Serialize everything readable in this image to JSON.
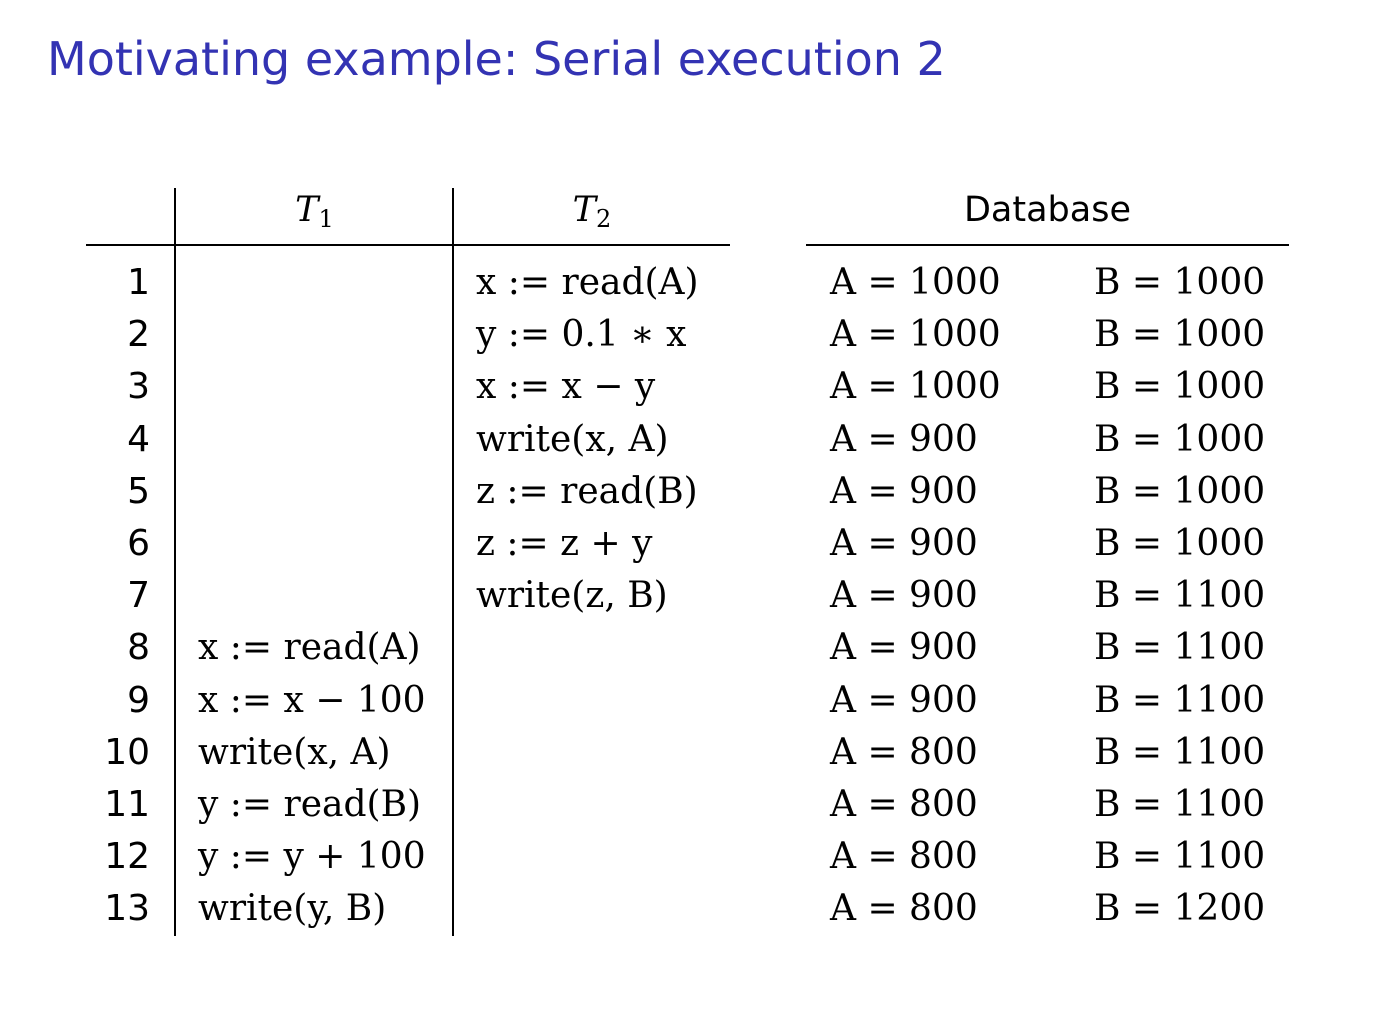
{
  "slide": {
    "title": "Motivating example: Serial execution 2"
  },
  "table": {
    "header": {
      "t1_symbol": "T",
      "t1_sub": "1",
      "t2_symbol": "T",
      "t2_sub": "2",
      "database": "Database"
    },
    "rows": [
      {
        "n": "1",
        "t1": "",
        "t2": "x := read(A)",
        "a": "A = 1000",
        "b": "B = 1000"
      },
      {
        "n": "2",
        "t1": "",
        "t2": "y := 0.1 ∗ x",
        "a": "A = 1000",
        "b": "B = 1000"
      },
      {
        "n": "3",
        "t1": "",
        "t2": "x := x − y",
        "a": "A = 1000",
        "b": "B = 1000"
      },
      {
        "n": "4",
        "t1": "",
        "t2": "write(x, A)",
        "a": "A = 900",
        "b": "B = 1000"
      },
      {
        "n": "5",
        "t1": "",
        "t2": "z := read(B)",
        "a": "A = 900",
        "b": "B = 1000"
      },
      {
        "n": "6",
        "t1": "",
        "t2": "z := z + y",
        "a": "A = 900",
        "b": "B = 1000"
      },
      {
        "n": "7",
        "t1": "",
        "t2": "write(z, B)",
        "a": "A = 900",
        "b": "B = 1100"
      },
      {
        "n": "8",
        "t1": "x := read(A)",
        "t2": "",
        "a": "A = 900",
        "b": "B = 1100"
      },
      {
        "n": "9",
        "t1": "x := x − 100",
        "t2": "",
        "a": "A = 900",
        "b": "B = 1100"
      },
      {
        "n": "10",
        "t1": "write(x, A)",
        "t2": "",
        "a": "A = 800",
        "b": "B = 1100"
      },
      {
        "n": "11",
        "t1": "y := read(B)",
        "t2": "",
        "a": "A = 800",
        "b": "B = 1100"
      },
      {
        "n": "12",
        "t1": "y := y + 100",
        "t2": "",
        "a": "A = 800",
        "b": "B = 1100"
      },
      {
        "n": "13",
        "t1": "write(y, B)",
        "t2": "",
        "a": "A = 800",
        "b": "B = 1200"
      }
    ]
  }
}
